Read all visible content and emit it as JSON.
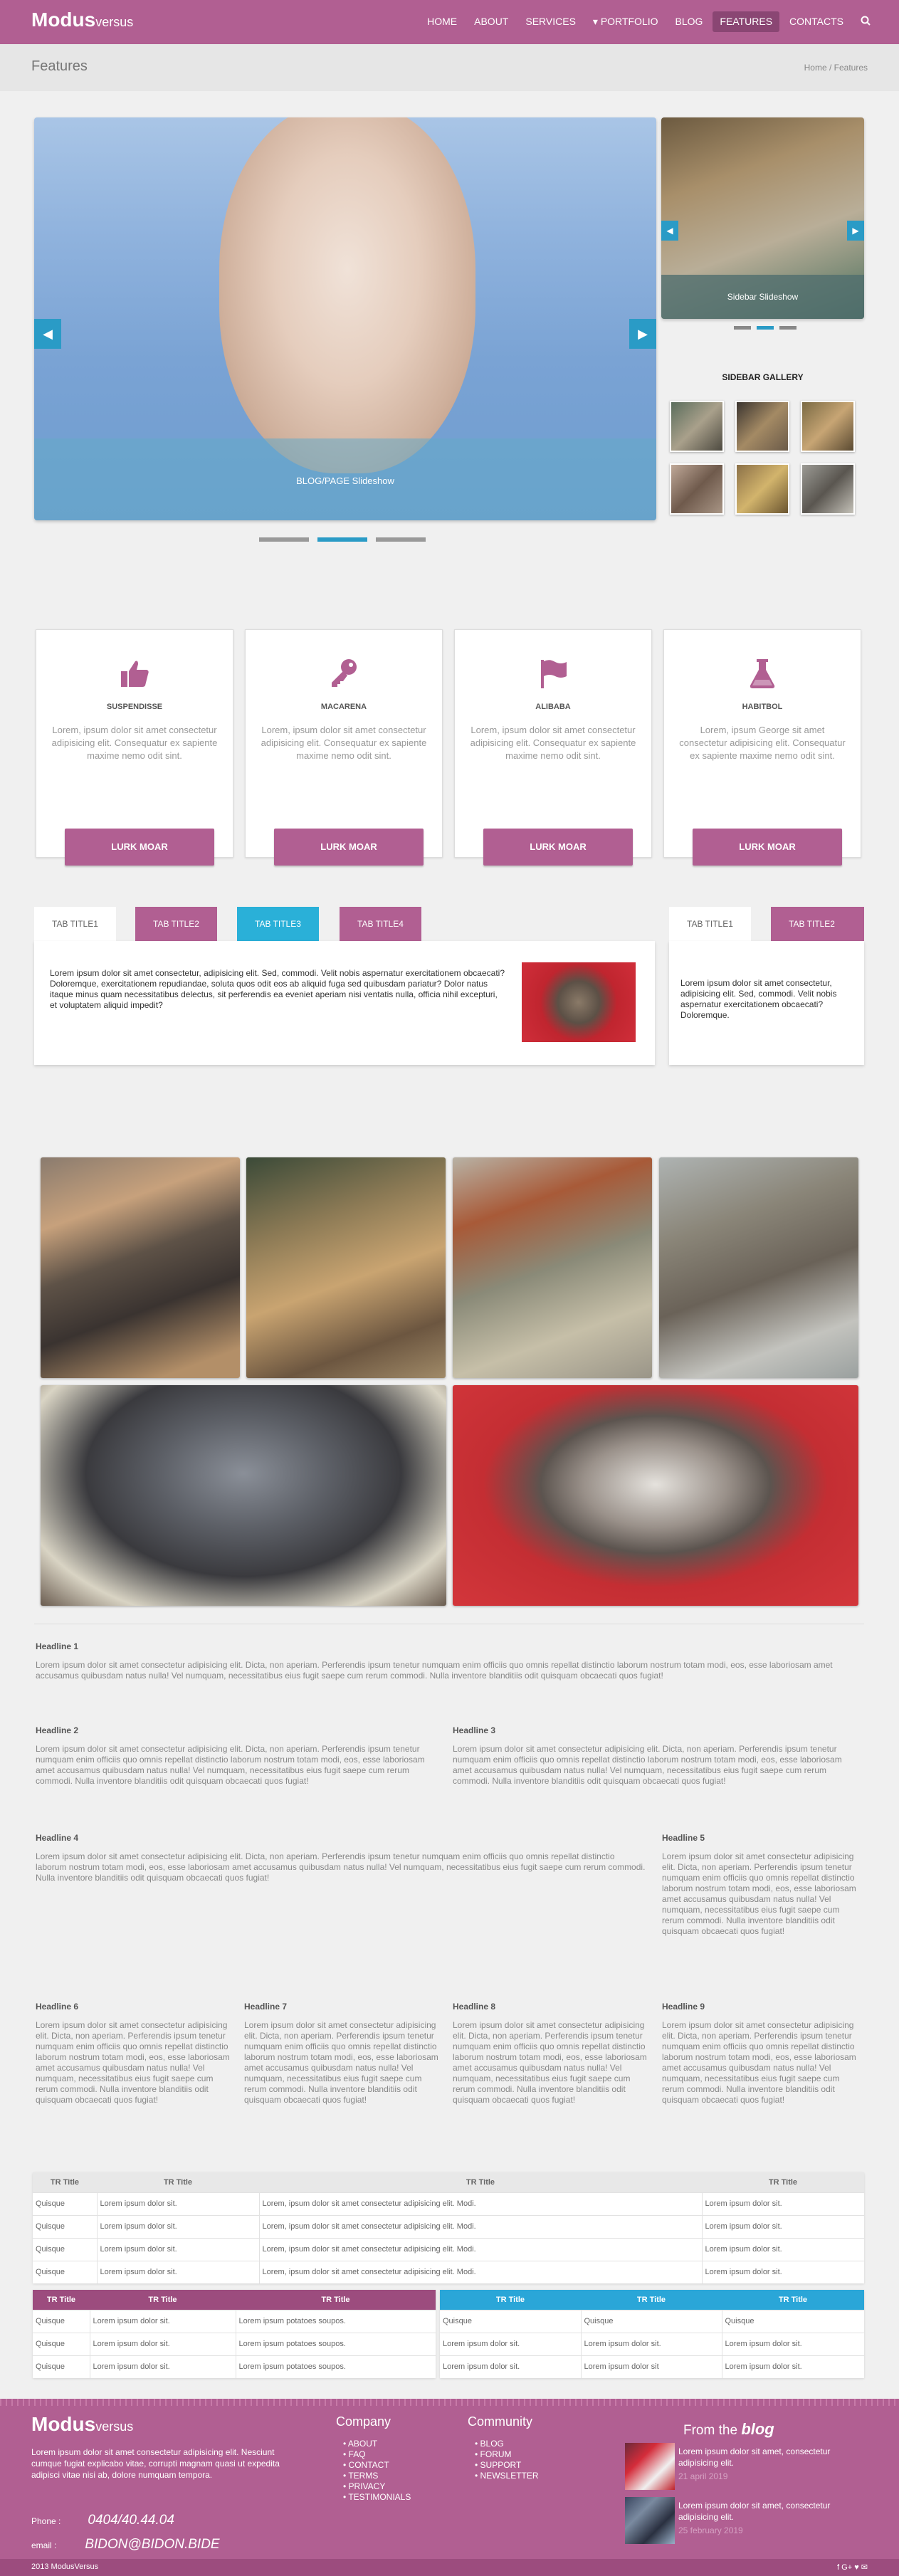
{
  "brand": {
    "bold": "Modus",
    "light": "versus"
  },
  "nav": {
    "items": [
      "HOME",
      "ABOUT",
      "SERVICES",
      "PORTFOLIO",
      "BLOG",
      "FEATURES",
      "CONTACTS"
    ],
    "active": "FEATURES",
    "dropdown_icon": "caret-down-icon",
    "search_icon": "search-icon"
  },
  "page": {
    "title": "Features",
    "breadcrumb": "Home / Features"
  },
  "slider": {
    "caption": "BLOG/PAGE Slideshow",
    "accent": "#2a9bc6"
  },
  "sidebar_slider": {
    "caption": "Sidebar Slideshow"
  },
  "sidebar_gallery": {
    "title": "SIDEBAR GALLERY"
  },
  "features": [
    {
      "icon": "thumbs-up-icon",
      "title": "SUSPENDISSE",
      "text": "Lorem, ipsum dolor sit amet consectetur adipisicing elit. Consequatur ex sapiente maxime nemo odit sint.",
      "button": "LURK MOAR"
    },
    {
      "icon": "key-icon",
      "title": "MACARENA",
      "text": "Lorem, ipsum dolor sit amet consectetur adipisicing elit. Consequatur ex sapiente maxime nemo odit sint.",
      "button": "LURK MOAR"
    },
    {
      "icon": "flag-icon",
      "title": "ALIBABA",
      "text": "Lorem, ipsum dolor sit amet consectetur adipisicing elit. Consequatur ex sapiente maxime nemo odit sint.",
      "button": "LURK MOAR"
    },
    {
      "icon": "flask-icon",
      "title": "HABITBOL",
      "text": "Lorem, ipsum George sit amet consectetur adipisicing elit. Consequatur ex sapiente maxime nemo odit sint.",
      "button": "LURK MOAR"
    }
  ],
  "tabs": {
    "main": [
      "TAB TITLE1",
      "TAB TITLE2",
      "TAB TITLE3",
      "TAB TITLE4"
    ],
    "main_text": "Lorem ipsum dolor sit amet consectetur, adipisicing elit. Sed, commodi. Velit nobis aspernatur exercitationem obcaecati? Doloremque, exercitationem repudiandae, soluta quos odit eos ab aliquid fuga sed quibusdam pariatur? Dolor natus itaque minus quam necessitatibus delectus, sit perferendis ea eveniet aperiam nisi ventatis nulla, officia nihil excepturi, et voluptatem aliquid impedit?",
    "side": [
      "TAB TITLE1",
      "TAB TITLE2"
    ],
    "side_text": "Lorem ipsum dolor sit amet consectetur, adipisicing elit. Sed, commodi. Velit nobis aspernatur exercitationem obcaecati? Doloremque."
  },
  "headlines": [
    {
      "title": "Headline 1",
      "text": "Lorem ipsum dolor sit amet consectetur adipisicing elit. Dicta, non aperiam. Perferendis ipsum tenetur numquam enim officiis quo omnis repellat distinctio laborum nostrum totam modi, eos, esse laboriosam amet accusamus quibusdam natus nulla! Vel numquam, necessitatibus eius fugit saepe cum rerum commodi. Nulla inventore blanditiis odit quisquam obcaecati quos fugiat!"
    },
    {
      "title": "Headline 2",
      "text": "Lorem ipsum dolor sit amet consectetur adipisicing elit. Dicta, non aperiam. Perferendis ipsum tenetur numquam enim officiis quo omnis repellat distinctio laborum nostrum totam modi, eos, esse laboriosam amet accusamus quibusdam natus nulla! Vel numquam, necessitatibus eius fugit saepe cum rerum commodi. Nulla inventore blanditiis odit quisquam obcaecati quos fugiat!"
    },
    {
      "title": "Headline 3",
      "text": "Lorem ipsum dolor sit amet consectetur adipisicing elit. Dicta, non aperiam. Perferendis ipsum tenetur numquam enim officiis quo omnis repellat distinctio laborum nostrum totam modi, eos, esse laboriosam amet accusamus quibusdam natus nulla! Vel numquam, necessitatibus eius fugit saepe cum rerum commodi. Nulla inventore blanditiis odit quisquam obcaecati quos fugiat!"
    },
    {
      "title": "Headline 4",
      "text": "Lorem ipsum dolor sit amet consectetur adipisicing elit. Dicta, non aperiam. Perferendis ipsum tenetur numquam enim officiis quo omnis repellat distinctio laborum nostrum totam modi, eos, esse laboriosam amet accusamus quibusdam natus nulla! Vel numquam, necessitatibus eius fugit saepe cum rerum commodi. Nulla inventore blanditiis odit quisquam obcaecati quos fugiat!"
    },
    {
      "title": "Headline 5",
      "text": "Lorem ipsum dolor sit amet consectetur adipisicing elit. Dicta, non aperiam. Perferendis ipsum tenetur numquam enim officiis quo omnis repellat distinctio laborum nostrum totam modi, eos, esse laboriosam amet accusamus quibusdam natus nulla! Vel numquam, necessitatibus eius fugit saepe cum rerum commodi. Nulla inventore blanditiis odit quisquam obcaecati quos fugiat!"
    },
    {
      "title": "Headline 6",
      "text": "Lorem ipsum dolor sit amet consectetur adipisicing elit. Dicta, non aperiam. Perferendis ipsum tenetur numquam enim officiis quo omnis repellat distinctio laborum nostrum totam modi, eos, esse laboriosam amet accusamus quibusdam natus nulla! Vel numquam, necessitatibus eius fugit saepe cum rerum commodi. Nulla inventore blanditiis odit quisquam obcaecati quos fugiat!"
    },
    {
      "title": "Headline 7",
      "text": "Lorem ipsum dolor sit amet consectetur adipisicing elit. Dicta, non aperiam. Perferendis ipsum tenetur numquam enim officiis quo omnis repellat distinctio laborum nostrum totam modi, eos, esse laboriosam amet accusamus quibusdam natus nulla! Vel numquam, necessitatibus eius fugit saepe cum rerum commodi. Nulla inventore blanditiis odit quisquam obcaecati quos fugiat!"
    },
    {
      "title": "Headline 8",
      "text": "Lorem ipsum dolor sit amet consectetur adipisicing elit. Dicta, non aperiam. Perferendis ipsum tenetur numquam enim officiis quo omnis repellat distinctio laborum nostrum totam modi, eos, esse laboriosam amet accusamus quibusdam natus nulla! Vel numquam, necessitatibus eius fugit saepe cum rerum commodi. Nulla inventore blanditiis odit quisquam obcaecati quos fugiat!"
    },
    {
      "title": "Headline 9",
      "text": "Lorem ipsum dolor sit amet consectetur adipisicing elit. Dicta, non aperiam. Perferendis ipsum tenetur numquam enim officiis quo omnis repellat distinctio laborum nostrum totam modi, eos, esse laboriosam amet accusamus quibusdam natus nulla! Vel numquam, necessitatibus eius fugit saepe cum rerum commodi. Nulla inventore blanditiis odit quisquam obcaecati quos fugiat!"
    }
  ],
  "table_grey": {
    "headers": [
      "TR Title",
      "TR Title",
      "TR Title",
      "TR Title"
    ],
    "rows": [
      [
        "Quisque",
        "Lorem ipsum dolor sit.",
        "Lorem, ipsum dolor sit amet consectetur adipisicing elit. Modi.",
        "Lorem ipsum dolor sit."
      ],
      [
        "Quisque",
        "Lorem ipsum dolor sit.",
        "Lorem, ipsum dolor sit amet consectetur adipisicing elit. Modi.",
        "Lorem ipsum dolor sit."
      ],
      [
        "Quisque",
        "Lorem ipsum dolor sit.",
        "Lorem, ipsum dolor sit amet consectetur adipisicing elit. Modi.",
        "Lorem ipsum dolor sit."
      ],
      [
        "Quisque",
        "Lorem ipsum dolor sit.",
        "Lorem, ipsum dolor sit amet consectetur adipisicing elit. Modi.",
        "Lorem ipsum dolor sit."
      ]
    ]
  },
  "table_purple": {
    "headers": [
      "TR Title",
      "TR Title",
      "TR Title"
    ],
    "rows": [
      [
        "Quisque",
        "Lorem ipsum dolor sit.",
        "Lorem ipsum potatoes soupos."
      ],
      [
        "Quisque",
        "Lorem ipsum dolor sit.",
        "Lorem ipsum potatoes soupos."
      ],
      [
        "Quisque",
        "Lorem ipsum dolor sit.",
        "Lorem ipsum potatoes soupos."
      ]
    ]
  },
  "table_blue": {
    "headers": [
      "TR Title",
      "TR Title",
      "TR Title"
    ],
    "rows": [
      [
        "Quisque",
        "Quisque",
        "Quisque"
      ],
      [
        "Lorem ipsum dolor sit.",
        "Lorem ipsum dolor sit.",
        "Lorem ipsum dolor sit."
      ],
      [
        "Lorem ipsum dolor sit.",
        "Lorem ipsum dolor sit",
        "Lorem ipsum dolor sit."
      ]
    ]
  },
  "footer": {
    "about": "Lorem ipsum dolor sit amet consectetur adipisicing elit. Nesciunt cumque fugiat explicabo vitae, corrupti magnam quasi ut expedita adipisci vitae nisi ab, dolore numquam tempora.",
    "phone_label": "Phone :",
    "phone": "0404/40.44.04",
    "email_label": "email :",
    "email": "BIDON@BIDON.BIDE",
    "company_title": "Company",
    "company_links": [
      "ABOUT",
      "FAQ",
      "CONTACT",
      "TERMS",
      "PRIVACY",
      "TESTIMONIALS"
    ],
    "community_title": "Community",
    "community_links": [
      "BLOG",
      "FORUM",
      "SUPPORT",
      "NEWSLETTER"
    ],
    "blog_title_pre": "From the",
    "blog_title": "blog",
    "blog_posts": [
      {
        "title": "Lorem ipsum dolor sit amet, consectetur adipisicing elit.",
        "date": "21 april 2019"
      },
      {
        "title": "Lorem ipsum dolor sit amet, consectetur adipisicing elit.",
        "date": "25 february 2019"
      }
    ],
    "copyright": "2013 ModusVersus",
    "social": "f G+ ♥ ✉"
  }
}
